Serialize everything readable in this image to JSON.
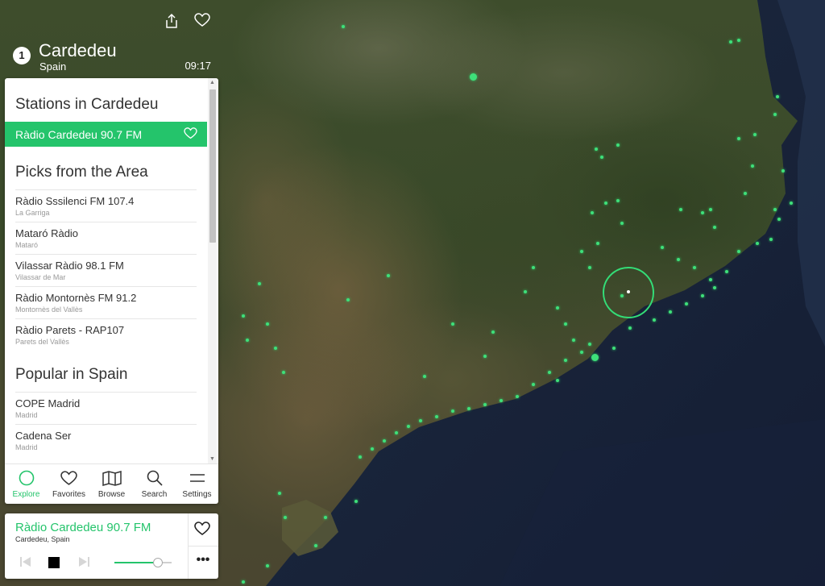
{
  "header": {
    "step": "1",
    "city": "Cardedeu",
    "country": "Spain",
    "time": "09:17",
    "share_icon": "share-icon",
    "favorite_icon": "heart-icon"
  },
  "panel": {
    "stations_title": "Stations in Cardedeu",
    "active_station": "Ràdio Cardedeu 90.7 FM",
    "picks_title": "Picks from the Area",
    "picks": [
      {
        "name": "Ràdio Sssilenci FM 107.4",
        "location": "La Garriga"
      },
      {
        "name": "Mataró Ràdio",
        "location": "Mataró"
      },
      {
        "name": "Vilassar Ràdio 98.1 FM",
        "location": "Vilassar de Mar"
      },
      {
        "name": "Ràdio Montornès FM 91.2",
        "location": "Montornès del Vallès"
      },
      {
        "name": "Ràdio Parets - RAP107",
        "location": "Parets del Vallès"
      }
    ],
    "popular_title": "Popular in Spain",
    "popular": [
      {
        "name": "COPE Madrid",
        "location": "Madrid"
      },
      {
        "name": "Cadena Ser",
        "location": "Madrid"
      }
    ]
  },
  "nav": {
    "explore": "Explore",
    "favorites": "Favorites",
    "browse": "Browse",
    "search": "Search",
    "settings": "Settings",
    "active": "explore"
  },
  "player": {
    "title": "Ràdio Cardedeu 90.7 FM",
    "subtitle": "Cardedeu, Spain",
    "more": "•••",
    "volume_fraction": 0.75
  },
  "colors": {
    "accent": "#24c46b",
    "station_dot": "#3ee07a"
  }
}
